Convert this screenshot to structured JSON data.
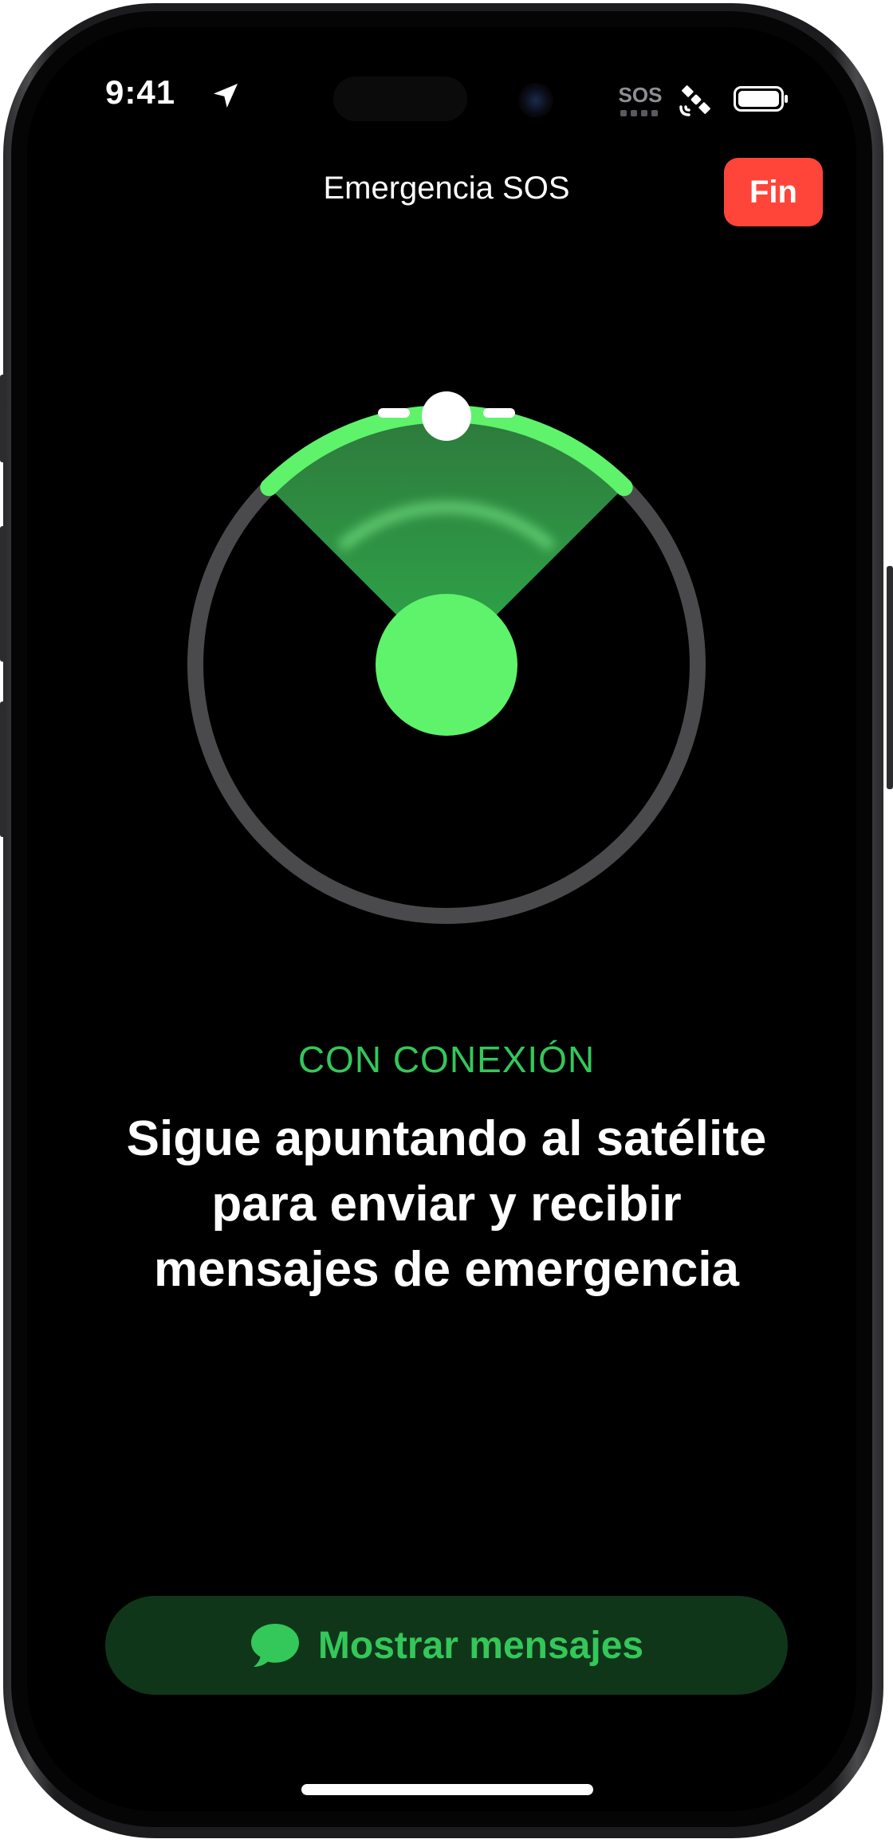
{
  "status_bar": {
    "time": "9:41",
    "sos_label": "SOS",
    "icons": [
      "location-arrow-icon",
      "sos-status-icon",
      "satellite-icon",
      "battery-icon"
    ]
  },
  "nav": {
    "title": "Emergencia SOS",
    "end_button": "Fin"
  },
  "connection": {
    "status": "CON CONEXIÓN",
    "instruction_lines": [
      "Sigue apuntando al satélite",
      "para enviar y recibir",
      "mensajes de emergencia"
    ]
  },
  "actions": {
    "show_messages": "Mostrar mensajes",
    "show_messages_icon": "message-bubble-icon"
  },
  "colors": {
    "accent_green": "#34c759",
    "bright_green": "#5ef36b",
    "end_red": "#ff453a",
    "button_bg": "#10361a"
  }
}
